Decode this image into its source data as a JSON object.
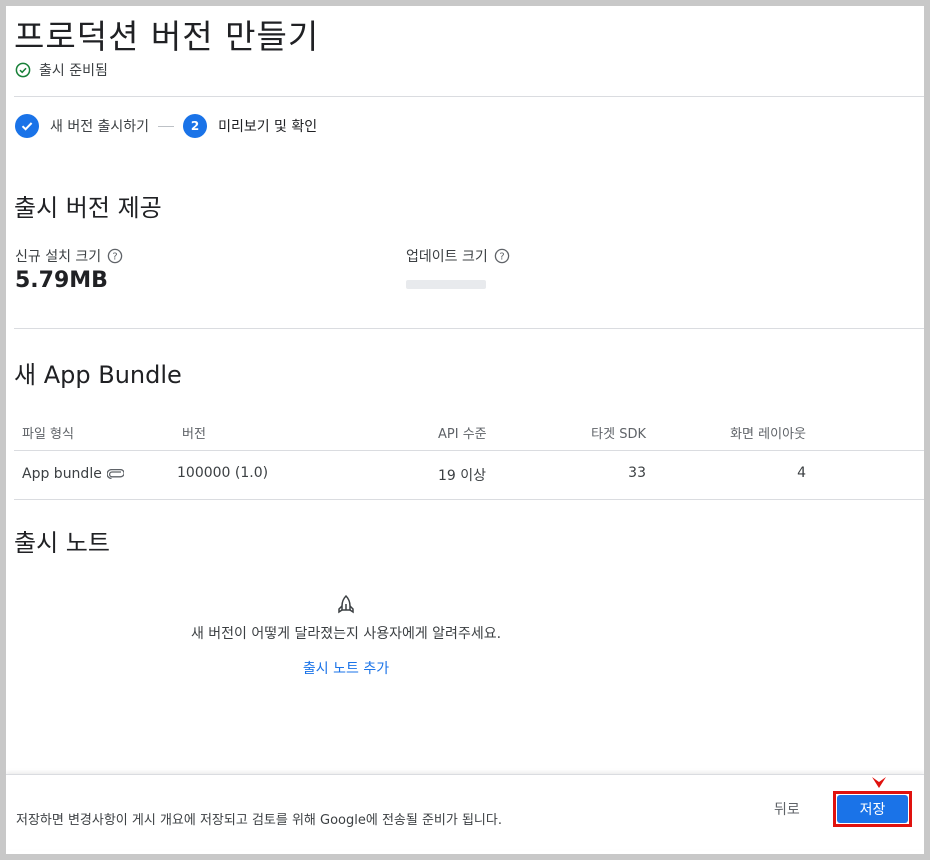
{
  "page": {
    "title": "프로덕션 버전 만들기",
    "status": "출시 준비됨"
  },
  "stepper": {
    "steps": [
      {
        "label": "새 버전 출시하기",
        "state": "done"
      },
      {
        "number": "2",
        "label": "미리보기 및 확인",
        "state": "active"
      }
    ]
  },
  "delivery": {
    "title": "출시 버전 제공",
    "install_label": "신규 설치 크기",
    "install_value": "5.79MB",
    "update_label": "업데이트 크기"
  },
  "bundle": {
    "title": "새 App Bundle",
    "columns": [
      "파일 형식",
      "버전",
      "API 수준",
      "타겟 SDK",
      "화면 레이아웃"
    ],
    "row": {
      "file_type": "App bundle",
      "version": "100000 (1.0)",
      "api": "19 이상",
      "target_sdk": "33",
      "layouts": "4"
    }
  },
  "notes": {
    "title": "출시 노트",
    "empty_text": "새 버전이 어떻게 달라졌는지 사용자에게 알려주세요.",
    "add_link": "출시 노트 추가"
  },
  "footer": {
    "message": "저장하면 변경사항이 게시 개요에 저장되고 검토를 위해 Google에 전송될 준비가 됩니다.",
    "back_label": "뒤로",
    "save_label": "저장"
  },
  "colors": {
    "accent": "#1a73e8",
    "success": "#188038",
    "highlight": "#e0120e"
  }
}
